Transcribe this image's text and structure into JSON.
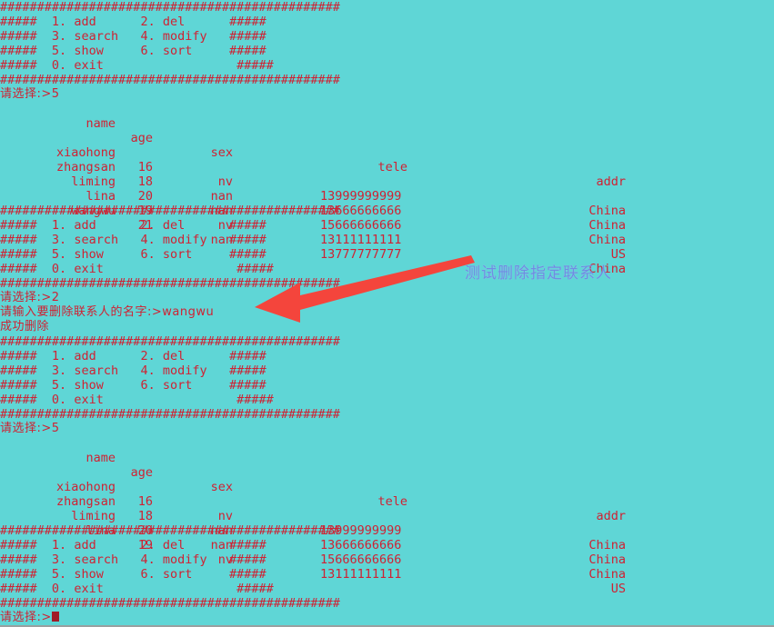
{
  "terminal": {
    "background_color": "#5fd6d6",
    "text_color": "#cf2233",
    "prompt_cursor": "block"
  },
  "menu": {
    "banner_line": "##############################################",
    "rows": [
      {
        "left_marker": "#####",
        "item1_num": "1.",
        "item1_label": "add",
        "item2_num": "2.",
        "item2_label": "del",
        "right_marker": "#####"
      },
      {
        "left_marker": "#####",
        "item1_num": "3.",
        "item1_label": "search",
        "item2_num": "4.",
        "item2_label": "modify",
        "right_marker": "#####"
      },
      {
        "left_marker": "#####",
        "item1_num": "5.",
        "item1_label": "show",
        "item2_num": "6.",
        "item2_label": "sort",
        "right_marker": "#####"
      },
      {
        "left_marker": "#####",
        "item1_num": "0.",
        "item1_label": "exit",
        "item2_num": "",
        "item2_label": "",
        "right_marker": "#####"
      }
    ]
  },
  "prompts": {
    "choose": "请选择:>",
    "choice_show_1": "5",
    "choice_del": "2",
    "ask_delete_name": "请输入要删除联系人的名字:>",
    "delete_name_value": "wangwu",
    "delete_success": "成功删除",
    "choice_show_2": "5",
    "choice_final": ""
  },
  "table": {
    "headers": {
      "name": "name",
      "age": "age",
      "sex": "sex",
      "tele": "tele",
      "addr": "addr"
    },
    "before_delete": [
      {
        "name": "xiaohong",
        "age": "16",
        "sex": "nv",
        "tele": "13999999999",
        "addr": "China"
      },
      {
        "name": "zhangsan",
        "age": "18",
        "sex": "nan",
        "tele": "13666666666",
        "addr": "China"
      },
      {
        "name": "liming",
        "age": "20",
        "sex": "nan",
        "tele": "15666666666",
        "addr": "China"
      },
      {
        "name": "lina",
        "age": "19",
        "sex": "nv",
        "tele": "13111111111",
        "addr": "US"
      },
      {
        "name": "wangwu",
        "age": "21",
        "sex": "nan",
        "tele": "13777777777",
        "addr": "China"
      }
    ],
    "after_delete": [
      {
        "name": "xiaohong",
        "age": "16",
        "sex": "nv",
        "tele": "13999999999",
        "addr": "China"
      },
      {
        "name": "zhangsan",
        "age": "18",
        "sex": "nan",
        "tele": "13666666666",
        "addr": "China"
      },
      {
        "name": "liming",
        "age": "20",
        "sex": "nan",
        "tele": "15666666666",
        "addr": "China"
      },
      {
        "name": "lina",
        "age": "19",
        "sex": "nv",
        "tele": "13111111111",
        "addr": "US"
      }
    ]
  },
  "annotation": {
    "text": "测试删除指定联系人",
    "text_color": "#6e8ee2",
    "arrow_color": "#f4453c"
  }
}
